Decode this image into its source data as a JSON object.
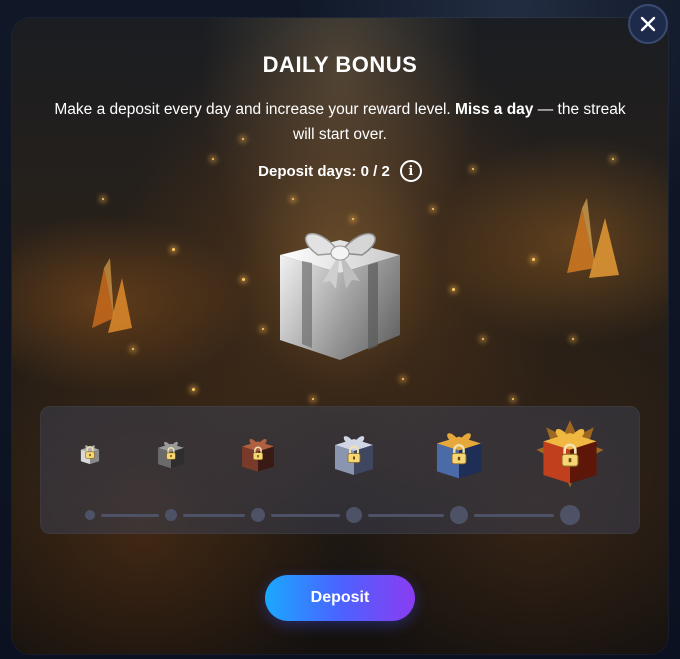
{
  "modal": {
    "title": "DAILY BONUS",
    "description_lead": "Make a deposit every day and increase your reward level. ",
    "description_bold": "Miss a day",
    "description_tail": " — the streak will start over.",
    "deposit_days_label": "Deposit days: 0 / 2",
    "info_icon": "info-icon",
    "close_icon": "close-icon",
    "deposit_button": "Deposit"
  },
  "reward_levels": {
    "count": 6,
    "completed": 0,
    "all_locked": true,
    "items": [
      {
        "tier": "silver-small",
        "icon": "lock-icon"
      },
      {
        "tier": "dark-small",
        "icon": "lock-icon"
      },
      {
        "tier": "bronze",
        "icon": "lock-icon"
      },
      {
        "tier": "steel",
        "icon": "lock-icon"
      },
      {
        "tier": "gold",
        "icon": "lock-icon"
      },
      {
        "tier": "ornate-gold",
        "icon": "lock-icon"
      }
    ]
  },
  "colors": {
    "accent_gradient_start": "#1aa8ff",
    "accent_gradient_end": "#8a3cf0",
    "close_button_bg": "#1d2a4a",
    "track_inactive": "#4d5266",
    "warm_glow": "#ffaa46"
  }
}
